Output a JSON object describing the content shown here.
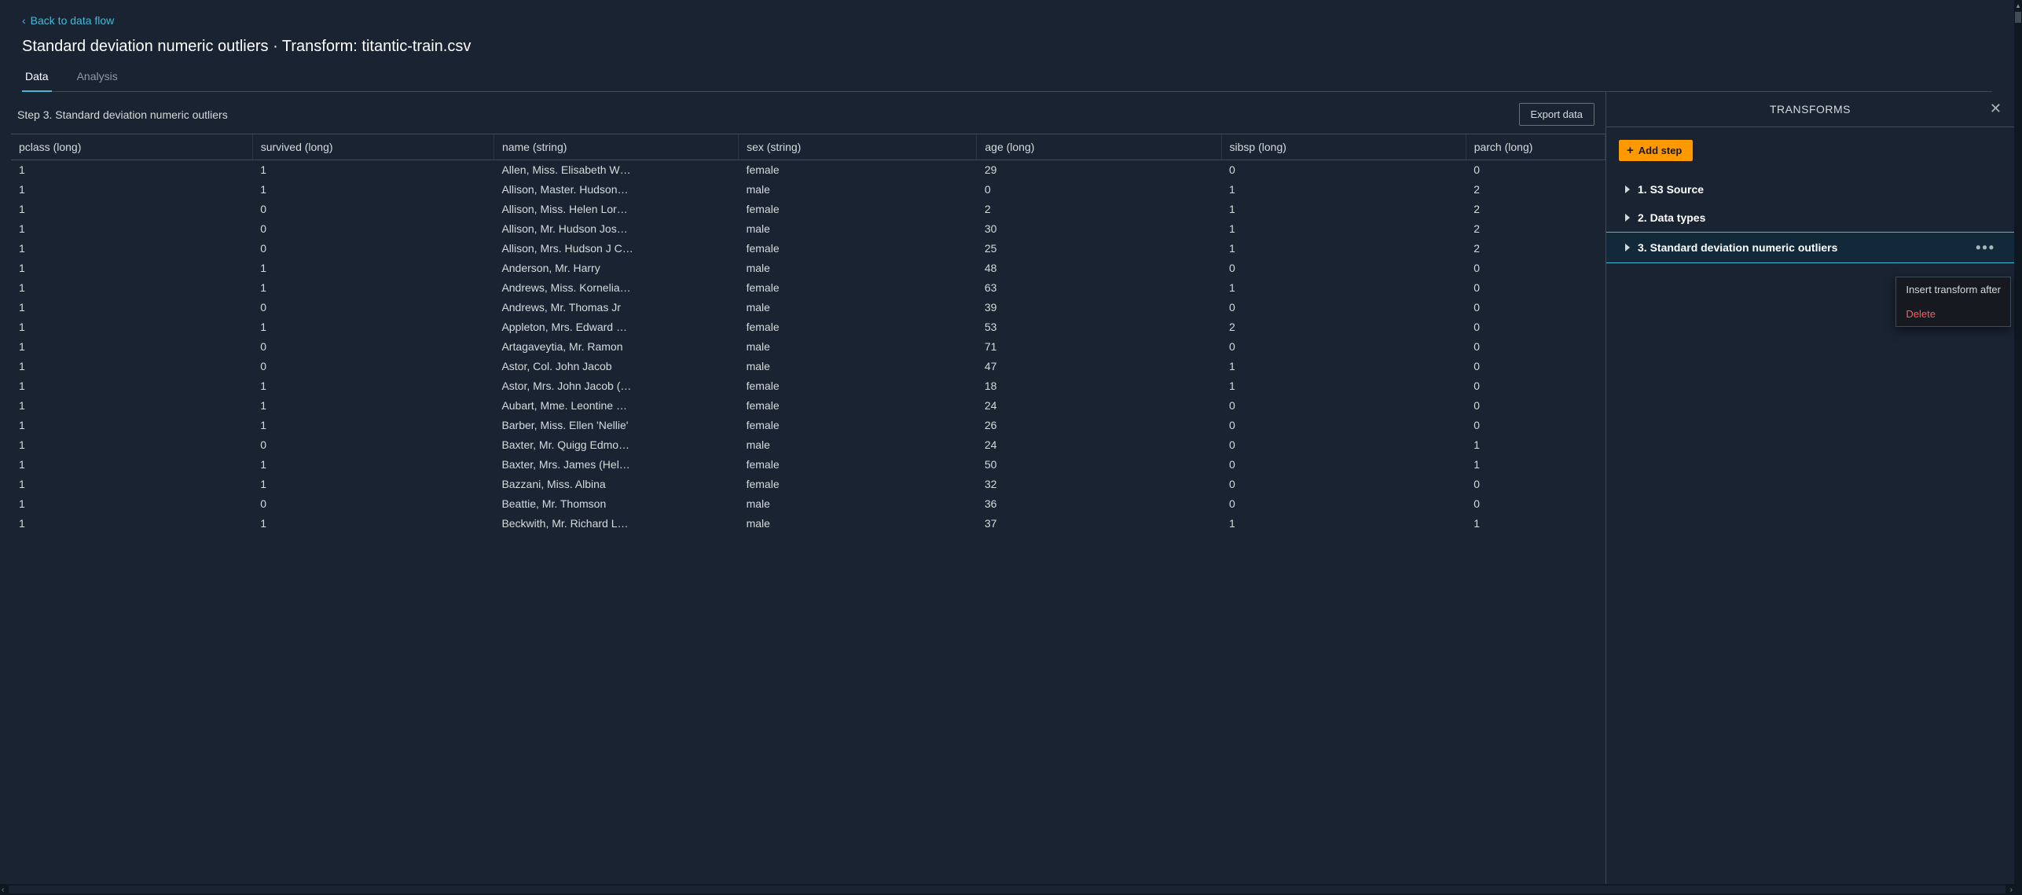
{
  "header": {
    "back_label": "Back to data flow",
    "title": "Standard deviation numeric outliers · Transform: titantic-train.csv"
  },
  "tabs": [
    {
      "label": "Data",
      "active": true
    },
    {
      "label": "Analysis",
      "active": false
    }
  ],
  "step_bar": {
    "label": "Step 3. Standard deviation numeric outliers",
    "export_label": "Export data"
  },
  "table": {
    "columns": [
      "pclass (long)",
      "survived (long)",
      "name (string)",
      "sex (string)",
      "age (long)",
      "sibsp (long)",
      "parch (long)"
    ],
    "rows": [
      [
        "1",
        "1",
        "Allen, Miss. Elisabeth W…",
        "female",
        "29",
        "0",
        "0"
      ],
      [
        "1",
        "1",
        "Allison, Master. Hudson…",
        "male",
        "0",
        "1",
        "2"
      ],
      [
        "1",
        "0",
        "Allison, Miss. Helen Lor…",
        "female",
        "2",
        "1",
        "2"
      ],
      [
        "1",
        "0",
        "Allison, Mr. Hudson Jos…",
        "male",
        "30",
        "1",
        "2"
      ],
      [
        "1",
        "0",
        "Allison, Mrs. Hudson J C…",
        "female",
        "25",
        "1",
        "2"
      ],
      [
        "1",
        "1",
        "Anderson, Mr. Harry",
        "male",
        "48",
        "0",
        "0"
      ],
      [
        "1",
        "1",
        "Andrews, Miss. Kornelia…",
        "female",
        "63",
        "1",
        "0"
      ],
      [
        "1",
        "0",
        "Andrews, Mr. Thomas Jr",
        "male",
        "39",
        "0",
        "0"
      ],
      [
        "1",
        "1",
        "Appleton, Mrs. Edward …",
        "female",
        "53",
        "2",
        "0"
      ],
      [
        "1",
        "0",
        "Artagaveytia, Mr. Ramon",
        "male",
        "71",
        "0",
        "0"
      ],
      [
        "1",
        "0",
        "Astor, Col. John Jacob",
        "male",
        "47",
        "1",
        "0"
      ],
      [
        "1",
        "1",
        "Astor, Mrs. John Jacob (…",
        "female",
        "18",
        "1",
        "0"
      ],
      [
        "1",
        "1",
        "Aubart, Mme. Leontine …",
        "female",
        "24",
        "0",
        "0"
      ],
      [
        "1",
        "1",
        "Barber, Miss. Ellen 'Nellie'",
        "female",
        "26",
        "0",
        "0"
      ],
      [
        "1",
        "0",
        "Baxter, Mr. Quigg Edmo…",
        "male",
        "24",
        "0",
        "1"
      ],
      [
        "1",
        "1",
        "Baxter, Mrs. James (Hel…",
        "female",
        "50",
        "0",
        "1"
      ],
      [
        "1",
        "1",
        "Bazzani, Miss. Albina",
        "female",
        "32",
        "0",
        "0"
      ],
      [
        "1",
        "0",
        "Beattie, Mr. Thomson",
        "male",
        "36",
        "0",
        "0"
      ],
      [
        "1",
        "1",
        "Beckwith, Mr. Richard L…",
        "male",
        "37",
        "1",
        "1"
      ]
    ]
  },
  "transforms": {
    "title": "TRANSFORMS",
    "add_step_label": "Add step",
    "steps": [
      {
        "label": "1. S3 Source",
        "selected": false
      },
      {
        "label": "2. Data types",
        "selected": false
      },
      {
        "label": "3. Standard deviation numeric outliers",
        "selected": true
      }
    ],
    "context_menu": [
      {
        "label": "Insert transform after",
        "danger": false
      },
      {
        "label": "Delete",
        "danger": true
      }
    ]
  }
}
